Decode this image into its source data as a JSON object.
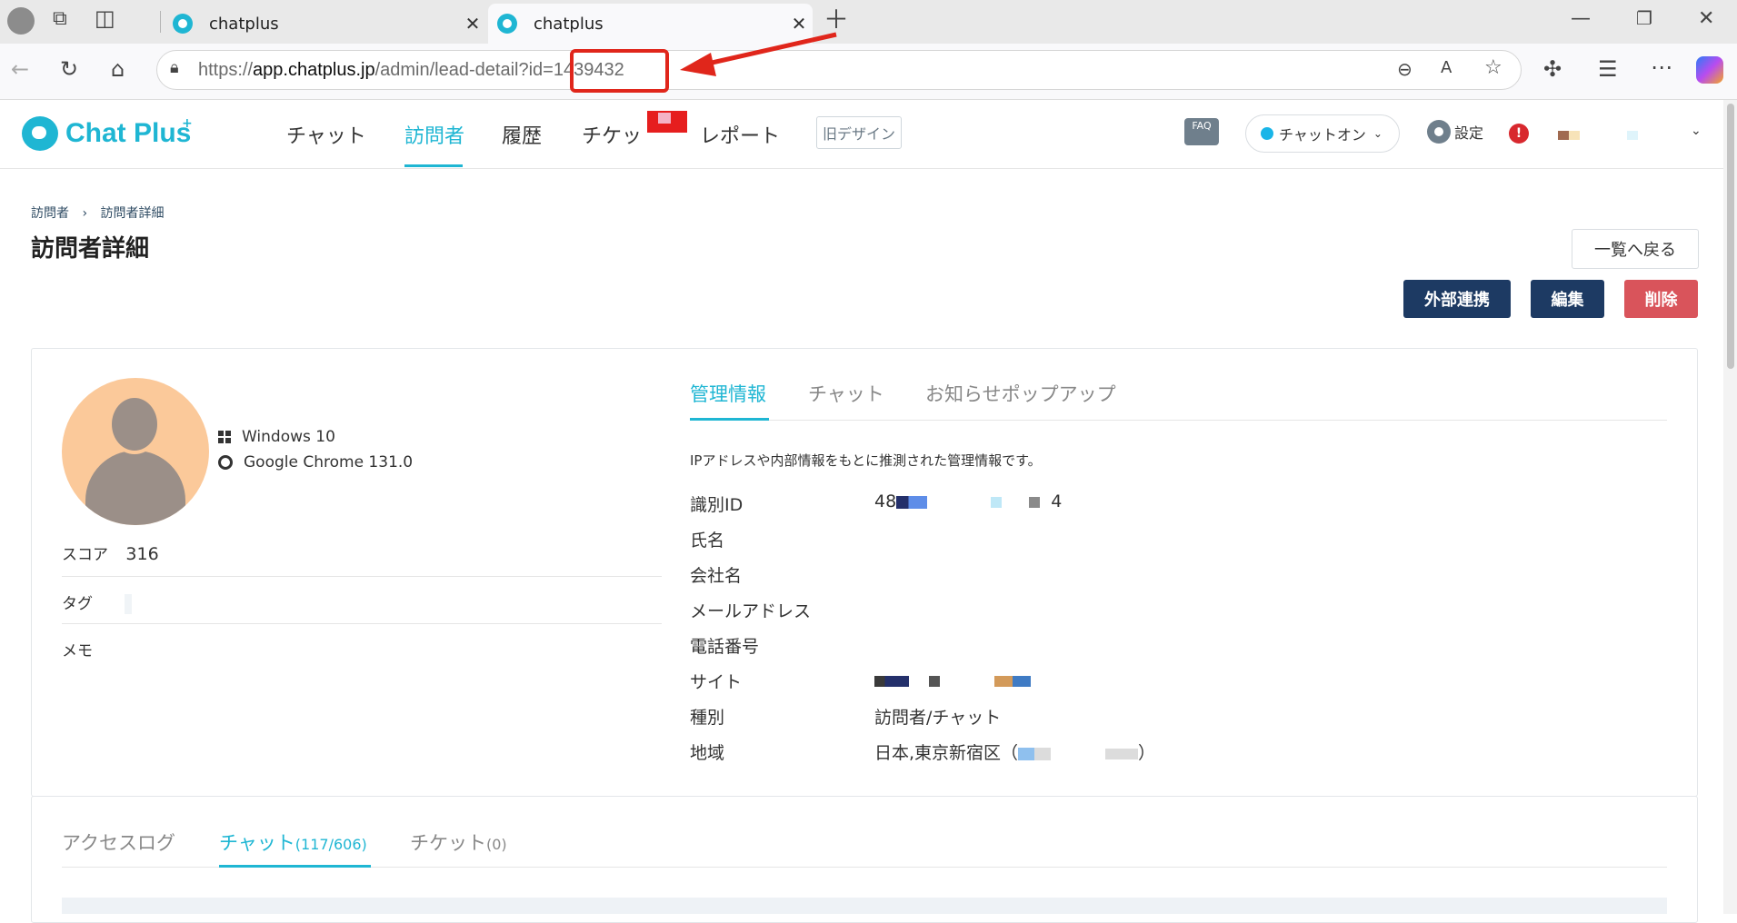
{
  "browser": {
    "tabs": [
      {
        "title": "chatplus"
      },
      {
        "title": "chatplus"
      }
    ],
    "url_prefix": "https://",
    "url_host": "app.chatplus.jp",
    "url_path": "/admin/lead-detail?id=",
    "url_id": "1439432"
  },
  "app": {
    "logo": "Chat Plus",
    "nav": [
      "チャット",
      "訪問者",
      "履歴",
      "チケッ",
      "レポート"
    ],
    "old_design": "旧デザイン",
    "faq": "FAQ",
    "chat_status": "チャットオン",
    "settings": "設定",
    "alert": "!"
  },
  "page": {
    "breadcrumb": [
      "訪問者",
      "訪問者詳細"
    ],
    "title": "訪問者詳細",
    "back_button": "一覧へ戻る",
    "buttons": {
      "external": "外部連携",
      "edit": "編集",
      "delete": "削除"
    }
  },
  "profile": {
    "os": "Windows 10",
    "browser": "Google Chrome 131.0",
    "score_label": "スコア",
    "score": "316",
    "tag_label": "タグ",
    "memo_label": "メモ"
  },
  "detail_tabs": [
    "管理情報",
    "チャット",
    "お知らせポップアップ"
  ],
  "management": {
    "note": "IPアドレスや内部情報をもとに推測された管理情報です。",
    "fields": [
      {
        "label": "識別ID",
        "value": "48",
        "value_suffix": "4"
      },
      {
        "label": "氏名",
        "value": ""
      },
      {
        "label": "会社名",
        "value": ""
      },
      {
        "label": "メールアドレス",
        "value": ""
      },
      {
        "label": "電話番号",
        "value": ""
      },
      {
        "label": "サイト",
        "value": ""
      },
      {
        "label": "種別",
        "value": "訪問者/チャット"
      },
      {
        "label": "地域",
        "value": "日本,東京新宿区（",
        "value_suffix": "）"
      }
    ]
  },
  "bottom_tabs": [
    {
      "label": "アクセスログ",
      "count": ""
    },
    {
      "label": "チャット",
      "count": "(117/606)"
    },
    {
      "label": "チケット",
      "count": "(0)"
    }
  ],
  "colors": {
    "accent": "#1fb6d3",
    "primary_button": "#1d3a63",
    "danger_button": "#d9545b",
    "annotation": "#e0261b"
  }
}
